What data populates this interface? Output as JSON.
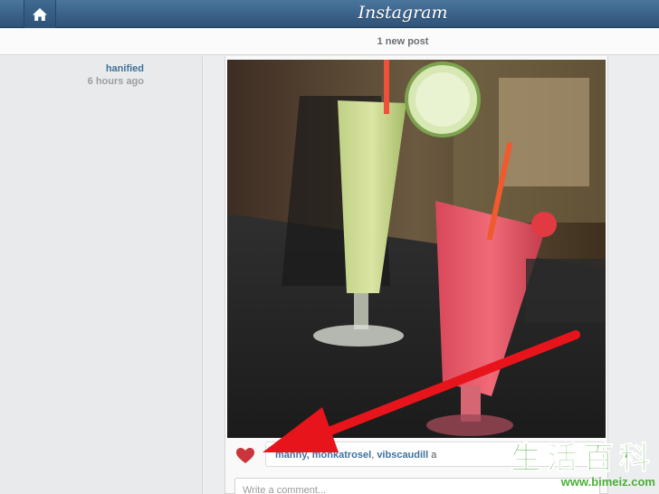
{
  "header": {
    "home_icon": "home-icon",
    "app_title": "Instagram"
  },
  "notice": {
    "text": "1 new post"
  },
  "post": {
    "author": "hanified",
    "timestamp": "6 hours ago",
    "like_icon": "heart-icon",
    "likers": [
      "monkatrosel",
      "vibscaudill"
    ],
    "likes_prefix": "manny,",
    "likes_suffix": "a",
    "comment_placeholder": "Write a comment..."
  },
  "watermark": {
    "title": "生活百科",
    "url": "www.bimeiz.com"
  },
  "colors": {
    "header_blue": "#3b6189",
    "link_blue": "#3f729b",
    "arrow_red": "#e8141b",
    "heart_red": "#c9353b"
  }
}
